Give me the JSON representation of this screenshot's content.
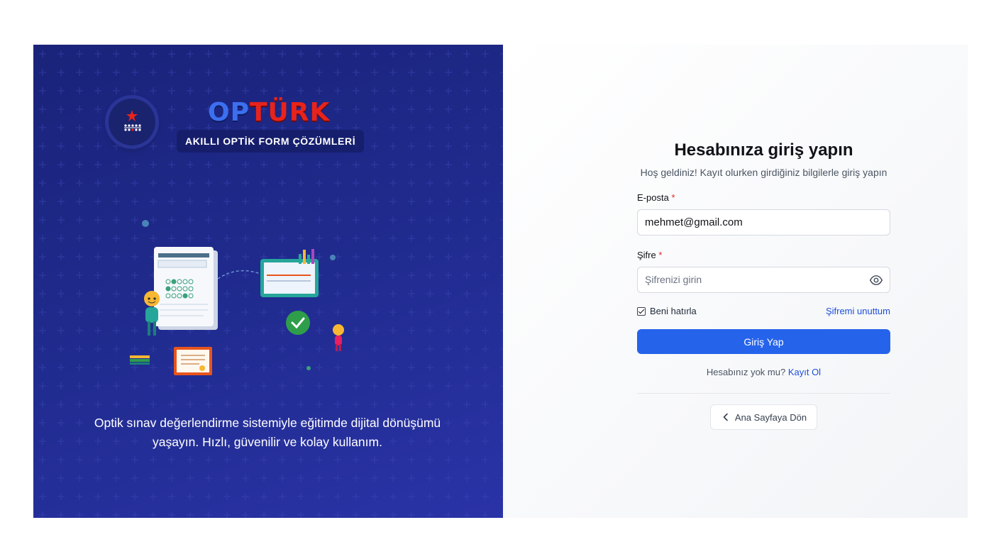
{
  "brand": {
    "name_part1": "OP",
    "name_part2": "TÜRK",
    "tagline": "AKILLI OPTİK FORM ÇÖZÜMLERİ"
  },
  "hero": {
    "description": "Optik sınav değerlendirme sistemiyle eğitimde dijital dönüşümü yaşayın. Hızlı, güvenilir ve kolay kullanım.",
    "background_color": "#1f2a8c"
  },
  "login": {
    "title": "Hesabınıza giriş yapın",
    "subtitle": "Hoş geldiniz! Kayıt olurken girdiğiniz bilgilerle giriş yapın",
    "email_label": "E-posta",
    "email_value": "mehmet@gmail.com",
    "password_label": "Şifre",
    "password_placeholder": "Şifrenizi girin",
    "required_mark": "*",
    "remember_label": "Beni hatırla",
    "remember_checked": true,
    "forgot_link": "Şifremi unuttum",
    "submit_label": "Giriş Yap",
    "no_account_text": "Hesabınız yok mu?",
    "signup_link": "Kayıt Ol",
    "back_label": "Ana Sayfaya Dön",
    "accent_color": "#2563eb"
  }
}
